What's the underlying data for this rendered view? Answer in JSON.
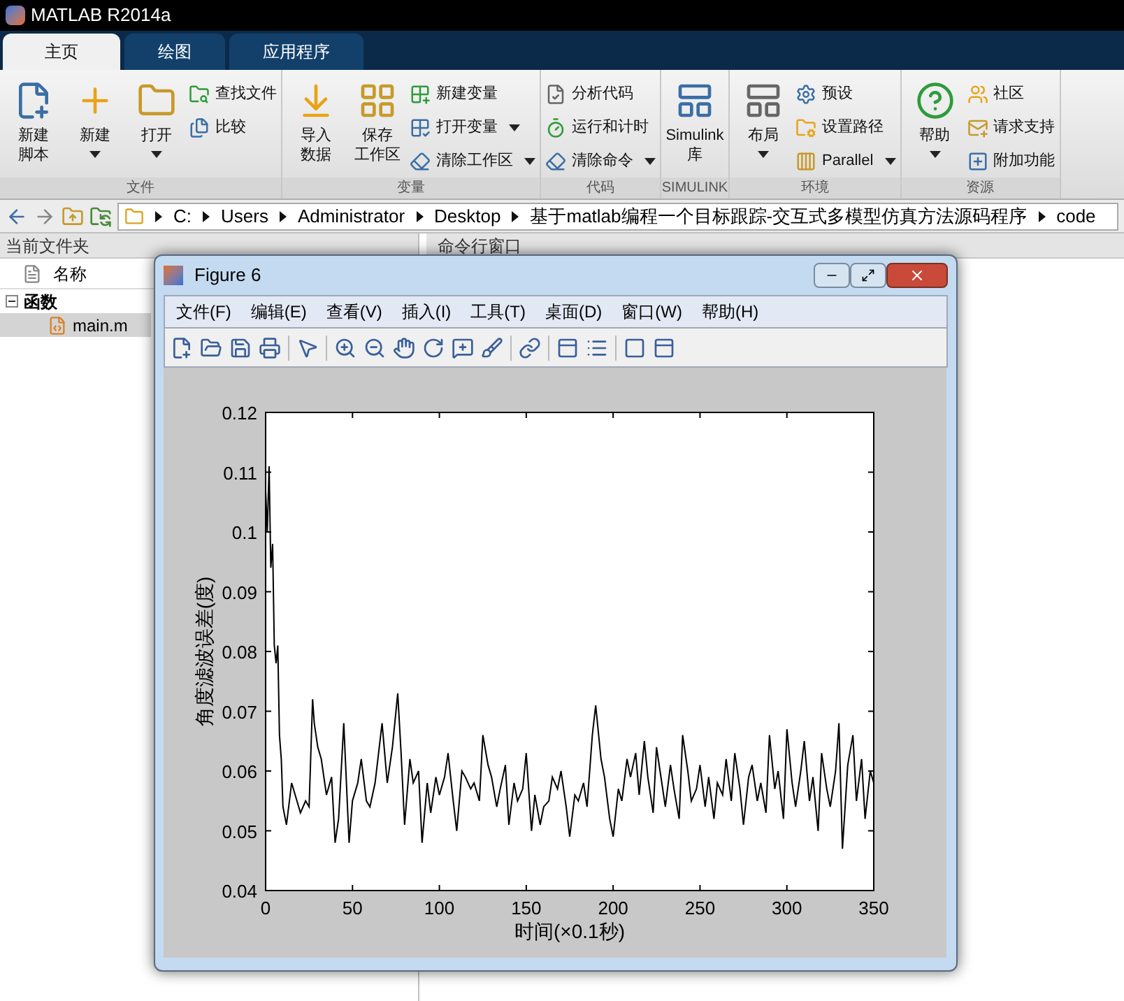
{
  "window": {
    "title": "MATLAB R2014a"
  },
  "ribbon": {
    "tabs": [
      {
        "label": "主页",
        "selected": true
      },
      {
        "label": "绘图",
        "selected": false
      },
      {
        "label": "应用程序",
        "selected": false
      }
    ],
    "groups": [
      {
        "label": "文件",
        "items": [
          {
            "kind": "large",
            "lines": [
              "新建",
              "脚本"
            ],
            "dropdown": false
          },
          {
            "kind": "large",
            "lines": [
              "新建"
            ],
            "dropdown": true
          },
          {
            "kind": "large",
            "lines": [
              "打开"
            ],
            "dropdown": true
          },
          {
            "kind": "small",
            "lines": [
              "查找文件"
            ],
            "dropdown": false
          },
          {
            "kind": "small",
            "lines": [
              "比较"
            ],
            "dropdown": false
          }
        ]
      },
      {
        "label": "变量",
        "items": [
          {
            "kind": "large",
            "lines": [
              "导入",
              "数据"
            ],
            "dropdown": false
          },
          {
            "kind": "large",
            "lines": [
              "保存",
              "工作区"
            ],
            "dropdown": false
          },
          {
            "kind": "small",
            "lines": [
              "新建变量"
            ],
            "dropdown": false
          },
          {
            "kind": "small",
            "lines": [
              "打开变量"
            ],
            "dropdown": true
          },
          {
            "kind": "small",
            "lines": [
              "清除工作区"
            ],
            "dropdown": true
          }
        ]
      },
      {
        "label": "代码",
        "items": [
          {
            "kind": "small",
            "lines": [
              "分析代码"
            ],
            "dropdown": false
          },
          {
            "kind": "small",
            "lines": [
              "运行和计时"
            ],
            "dropdown": false
          },
          {
            "kind": "small",
            "lines": [
              "清除命令"
            ],
            "dropdown": true
          }
        ]
      },
      {
        "label": "SIMULINK",
        "items": [
          {
            "kind": "large",
            "lines": [
              "Simulink",
              "库"
            ],
            "dropdown": false
          }
        ]
      },
      {
        "label": "环境",
        "items": [
          {
            "kind": "large",
            "lines": [
              "布局"
            ],
            "dropdown": true
          },
          {
            "kind": "small",
            "lines": [
              "预设"
            ],
            "dropdown": false
          },
          {
            "kind": "small",
            "lines": [
              "设置路径"
            ],
            "dropdown": false
          },
          {
            "kind": "small",
            "lines": [
              "Parallel"
            ],
            "dropdown": true
          }
        ]
      },
      {
        "label": "资源",
        "items": [
          {
            "kind": "large",
            "lines": [
              "帮助"
            ],
            "dropdown": true
          },
          {
            "kind": "small",
            "lines": [
              "社区"
            ],
            "dropdown": false
          },
          {
            "kind": "small",
            "lines": [
              "请求支持"
            ],
            "dropdown": false
          },
          {
            "kind": "small",
            "lines": [
              "附加功能"
            ],
            "dropdown": false
          }
        ]
      }
    ]
  },
  "address_bar": {
    "segments": [
      "C:",
      "Users",
      "Administrator",
      "Desktop",
      "基于matlab编程一个目标跟踪-交互式多模型仿真方法源码程序",
      "code"
    ]
  },
  "current_folder": {
    "title": "当前文件夹",
    "column": "名称",
    "tree": [
      {
        "label": "函数",
        "expanded": true,
        "children": [
          {
            "label": "main.m",
            "selected": true
          }
        ]
      }
    ]
  },
  "command_window": {
    "title": "命令行窗口"
  },
  "figure": {
    "title": "Figure 6",
    "menu": [
      "文件(F)",
      "编辑(E)",
      "查看(V)",
      "插入(I)",
      "工具(T)",
      "桌面(D)",
      "窗口(W)",
      "帮助(H)"
    ],
    "chart_data": {
      "type": "line",
      "xlabel": "时间(×0.1秒)",
      "ylabel": "角度滤波误差(度)",
      "xlim": [
        0,
        350
      ],
      "ylim": [
        0.04,
        0.12
      ],
      "xticks": [
        0,
        50,
        100,
        150,
        200,
        250,
        300,
        350
      ],
      "yticks": [
        0.04,
        0.05,
        0.06,
        0.07,
        0.08,
        0.09,
        0.1,
        0.11,
        0.12
      ],
      "x": [
        0,
        1,
        2,
        3,
        4,
        5,
        6,
        7,
        8,
        9,
        10,
        12,
        15,
        18,
        20,
        23,
        25,
        27,
        28,
        30,
        32,
        35,
        38,
        40,
        42,
        45,
        48,
        50,
        53,
        55,
        58,
        60,
        63,
        65,
        67,
        70,
        73,
        76,
        78,
        80,
        83,
        85,
        88,
        90,
        93,
        95,
        98,
        100,
        103,
        105,
        108,
        110,
        113,
        115,
        118,
        120,
        123,
        125,
        128,
        130,
        133,
        135,
        138,
        140,
        143,
        145,
        148,
        150,
        153,
        155,
        158,
        160,
        163,
        165,
        168,
        170,
        173,
        175,
        178,
        180,
        183,
        185,
        188,
        190,
        193,
        195,
        198,
        200,
        203,
        205,
        208,
        210,
        213,
        215,
        218,
        220,
        223,
        225,
        228,
        230,
        233,
        235,
        238,
        240,
        243,
        245,
        248,
        250,
        253,
        255,
        258,
        260,
        263,
        265,
        268,
        270,
        273,
        275,
        278,
        280,
        283,
        285,
        288,
        290,
        293,
        295,
        298,
        300,
        303,
        305,
        308,
        310,
        313,
        315,
        318,
        320,
        323,
        325,
        328,
        330,
        332,
        335,
        338,
        340,
        343,
        345,
        348,
        350
      ],
      "series": [
        {
          "color": "#000000",
          "values": [
            0.107,
            0.1,
            0.111,
            0.094,
            0.098,
            0.081,
            0.078,
            0.081,
            0.066,
            0.062,
            0.054,
            0.051,
            0.058,
            0.055,
            0.053,
            0.055,
            0.054,
            0.072,
            0.068,
            0.064,
            0.062,
            0.056,
            0.059,
            0.048,
            0.052,
            0.068,
            0.048,
            0.055,
            0.058,
            0.062,
            0.055,
            0.054,
            0.058,
            0.063,
            0.068,
            0.058,
            0.064,
            0.073,
            0.063,
            0.051,
            0.062,
            0.058,
            0.06,
            0.048,
            0.058,
            0.053,
            0.059,
            0.056,
            0.059,
            0.063,
            0.055,
            0.05,
            0.06,
            0.059,
            0.057,
            0.058,
            0.055,
            0.066,
            0.061,
            0.059,
            0.054,
            0.057,
            0.061,
            0.051,
            0.058,
            0.055,
            0.057,
            0.063,
            0.05,
            0.056,
            0.051,
            0.054,
            0.055,
            0.059,
            0.057,
            0.06,
            0.054,
            0.049,
            0.056,
            0.055,
            0.058,
            0.054,
            0.066,
            0.071,
            0.062,
            0.059,
            0.052,
            0.049,
            0.057,
            0.055,
            0.062,
            0.059,
            0.063,
            0.056,
            0.065,
            0.059,
            0.053,
            0.064,
            0.058,
            0.054,
            0.061,
            0.057,
            0.052,
            0.066,
            0.06,
            0.055,
            0.057,
            0.061,
            0.054,
            0.059,
            0.052,
            0.058,
            0.056,
            0.062,
            0.055,
            0.063,
            0.057,
            0.051,
            0.059,
            0.061,
            0.055,
            0.058,
            0.053,
            0.066,
            0.057,
            0.06,
            0.052,
            0.067,
            0.058,
            0.054,
            0.06,
            0.065,
            0.055,
            0.059,
            0.05,
            0.063,
            0.057,
            0.054,
            0.06,
            0.068,
            0.047,
            0.061,
            0.066,
            0.055,
            0.062,
            0.052,
            0.06,
            0.058
          ]
        }
      ]
    }
  }
}
